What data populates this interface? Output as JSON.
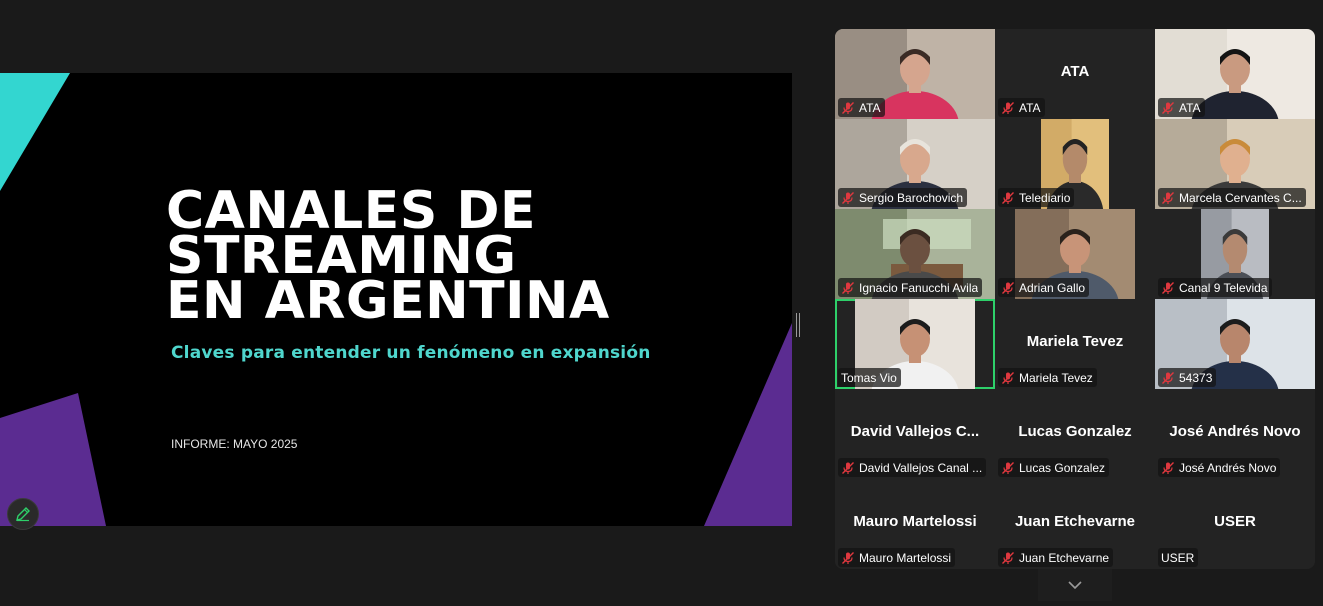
{
  "slide": {
    "title_lines": [
      "CANALES DE",
      "STREAMING",
      "EN ARGENTINA"
    ],
    "subtitle": "Claves para entender un fenómeno en expansión",
    "report": "INFORME: MAYO 2025",
    "colors": {
      "teal": "#33d6d0",
      "purple": "#5b2c91",
      "subtitle": "#4fd6cd"
    }
  },
  "toolbar": {
    "annotate_icon": "pencil-icon"
  },
  "gallery": {
    "active_border_color": "#2ed06a",
    "tiles": [
      {
        "name": "ATA",
        "center_label": "",
        "muted": true,
        "video": true
      },
      {
        "name": "ATA",
        "center_label": "ATA",
        "muted": true,
        "video": false
      },
      {
        "name": "ATA",
        "center_label": "",
        "muted": true,
        "video": true
      },
      {
        "name": "Sergio Barochovich",
        "center_label": "",
        "muted": true,
        "video": true
      },
      {
        "name": "Telediario",
        "center_label": "",
        "muted": true,
        "video": true
      },
      {
        "name": "Marcela Cervantes C...",
        "center_label": "",
        "muted": true,
        "video": true
      },
      {
        "name": "Ignacio Fanucchi Avila",
        "center_label": "",
        "muted": true,
        "video": true
      },
      {
        "name": "Adrian Gallo",
        "center_label": "",
        "muted": true,
        "video": true
      },
      {
        "name": "Canal 9 Televida",
        "center_label": "",
        "muted": true,
        "video": true
      },
      {
        "name": "Tomas Vio",
        "center_label": "",
        "muted": false,
        "video": true,
        "active_speaker": true
      },
      {
        "name": "Mariela Tevez",
        "center_label": "Mariela Tevez",
        "muted": true,
        "video": false
      },
      {
        "name": "54373",
        "center_label": "",
        "muted": true,
        "video": true
      },
      {
        "name": "David Vallejos Canal ...",
        "center_label": "David  Vallejos  C...",
        "muted": true,
        "video": false
      },
      {
        "name": "Lucas Gonzalez",
        "center_label": "Lucas Gonzalez",
        "muted": true,
        "video": false
      },
      {
        "name": "José Andrés Novo",
        "center_label": "José Andrés Novo",
        "muted": true,
        "video": false
      },
      {
        "name": "Mauro Martelossi",
        "center_label": "Mauro Martelossi",
        "muted": true,
        "video": false
      },
      {
        "name": "Juan Etchevarne",
        "center_label": "Juan Etchevarne",
        "muted": true,
        "video": false
      },
      {
        "name": "USER",
        "center_label": "USER",
        "muted": false,
        "video": false
      }
    ]
  },
  "scroll": {
    "icon": "chevron-down-icon"
  }
}
